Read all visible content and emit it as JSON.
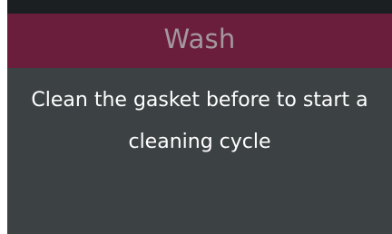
{
  "header": {
    "title": "Wash"
  },
  "message": {
    "line1": "Clean the gasket before to start a",
    "line2": "cleaning cycle"
  },
  "colors": {
    "header_bg": "#6b1e3c",
    "screen_bg": "#3c4144",
    "top_bar": "#1c1f21",
    "title_text": "#a3989d",
    "body_text": "#ffffff"
  }
}
